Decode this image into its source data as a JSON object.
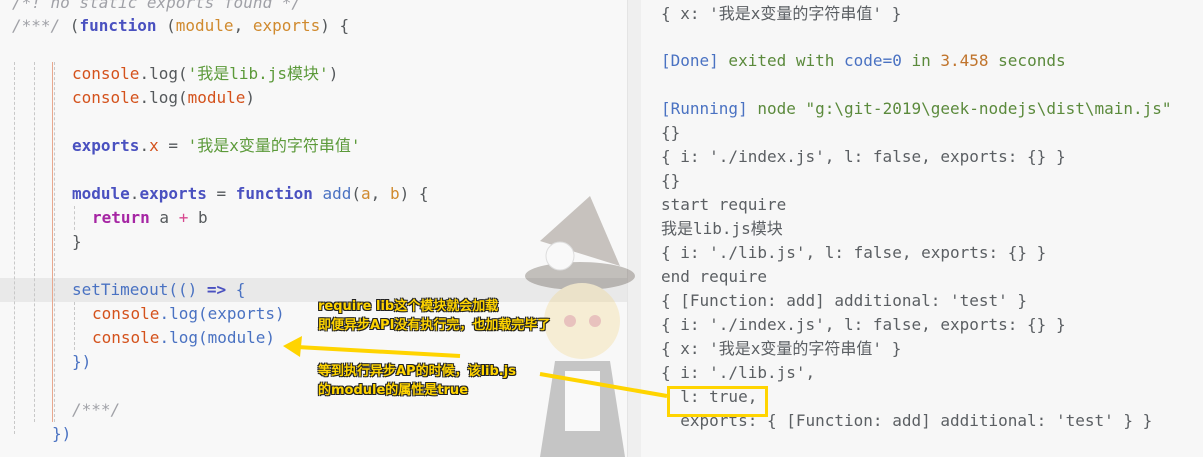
{
  "editor": {
    "lines": {
      "l0": "/*! no static exports found */",
      "l1a": "/***/ ",
      "l1b": "(",
      "l1c": "function",
      "l1d": " (",
      "l1e": "module",
      "l1f": ", ",
      "l1g": "exports",
      "l1h": ") {",
      "l3a": "console",
      "l3b": ".log(",
      "l3c": "'我是lib.js模块'",
      "l3d": ")",
      "l4a": "console",
      "l4b": ".log(",
      "l4c": "module",
      "l4d": ")",
      "l6a": "exports",
      "l6b": ".",
      "l6c": "x",
      "l6d": " = ",
      "l6e": "'我是x变量的字符串值'",
      "l8a": "module",
      "l8b": ".",
      "l8c": "exports",
      "l8d": " = ",
      "l8e": "function",
      "l8f": " ",
      "l8g": "add",
      "l8h": "(",
      "l8i": "a",
      "l8j": ", ",
      "l8k": "b",
      "l8l": ") {",
      "l9a": "return",
      "l9b": " a ",
      "l9c": "+",
      "l9d": " b",
      "l10": "}",
      "l12a": "setTimeout",
      "l12b": "(() ",
      "l12c": "=>",
      "l12d": " {",
      "l13a": "console",
      "l13b": ".log(",
      "l13c": "exports",
      "l13d": ")",
      "l14a": "console",
      "l14b": ".log(",
      "l14c": "module",
      "l14d": ")",
      "l15": "})",
      "l17": "/***/",
      "l18": "})"
    }
  },
  "output": {
    "o0": "{ x: '我是x变量的字符串值' }",
    "o2a": "[Done]",
    "o2b": " exited with ",
    "o2c": "code=0",
    "o2d": " in ",
    "o2e": "3.458",
    "o2f": " seconds",
    "o4a": "[Running]",
    "o4b": " node \"g:\\git-2019\\geek-nodejs\\dist\\main.js\"",
    "o5": "{}",
    "o6": "{ i: './index.js', l: false, exports: {} }",
    "o7": "{}",
    "o8": "start require",
    "o9": "我是lib.js模块",
    "o10": "{ i: './lib.js', l: false, exports: {} }",
    "o11": "end require",
    "o12": "{ [Function: add] additional: 'test' }",
    "o13": "{ i: './index.js', l: false, exports: {} }",
    "o14": "{ x: '我是x变量的字符串值' }",
    "o15": "{ i: './lib.js',",
    "o16": "  l: true,",
    "o17": "  exports: { [Function: add] additional: 'test' } }"
  },
  "annotations": {
    "a1_line1": "require lib这个模块就会加载",
    "a1_line2": "即便异步API没有执行完，也加载完毕了",
    "a2_line1": "等到执行异步AP的时候，该lib.js",
    "a2_line2": "的module的属性是true"
  },
  "colors": {
    "annotation_yellow": "#ffd400",
    "keyword": "#4a51c0",
    "string": "#5c9a3a",
    "variable": "#d4521c"
  }
}
